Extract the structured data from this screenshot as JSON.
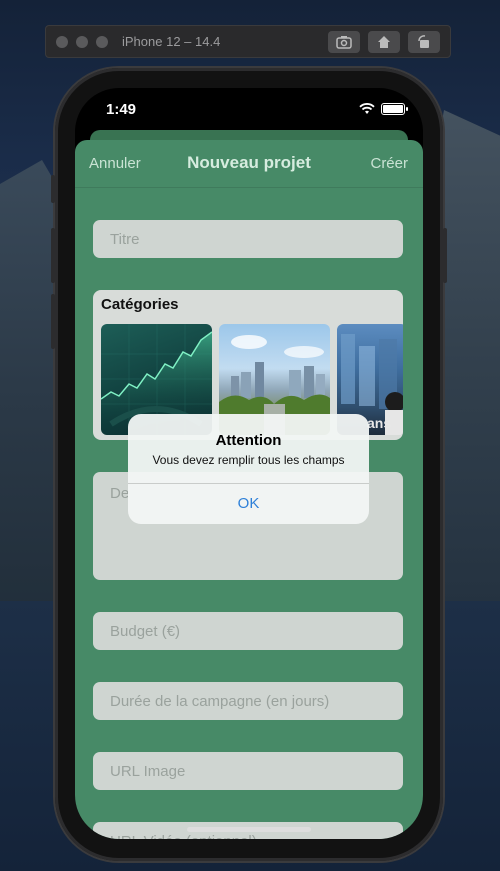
{
  "simulator": {
    "title": "iPhone 12 – 14.4",
    "icons": [
      "screenshot-icon",
      "home-icon",
      "rotate-icon"
    ]
  },
  "status_bar": {
    "time": "1:49",
    "icons": [
      "wifi-icon",
      "battery-icon"
    ]
  },
  "nav": {
    "cancel_label": "Annuler",
    "title": "Nouveau projet",
    "create_label": "Créer"
  },
  "form": {
    "title_placeholder": "Titre",
    "categories_title": "Catégories",
    "category_partial_label": "ans",
    "description_placeholder": "De",
    "budget_placeholder": "Budget (€)",
    "duration_placeholder": "Durée de la campagne (en jours)",
    "url_image_placeholder": "URL Image",
    "url_video_placeholder": "URL Vidéo (optionnel)"
  },
  "alert": {
    "title": "Attention",
    "message": "Vous devez remplir tous les champs",
    "ok_label": "OK"
  },
  "colors": {
    "sheet_green": "#478a67",
    "field_gray": "#cfd5d1",
    "link_blue": "#2f80d8"
  }
}
